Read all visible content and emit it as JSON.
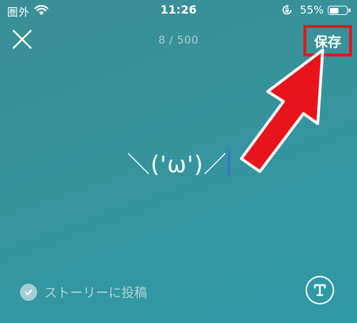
{
  "status_bar": {
    "carrier": "圏外",
    "time": "11:26",
    "battery_percent": "55%",
    "battery_level": 0.55
  },
  "header": {
    "counter": "8 / 500",
    "save_label": "保存"
  },
  "editor": {
    "text": "＼('ω')／"
  },
  "footer": {
    "story_label": "ストーリーに投稿"
  },
  "icons": {
    "close": "close-icon",
    "wifi": "wifi-icon",
    "rotation_lock": "rotation-lock-icon",
    "check": "check-icon",
    "text_style": "text-style-icon"
  },
  "colors": {
    "highlight": "#e8141b",
    "caret": "#3f6fd6"
  }
}
